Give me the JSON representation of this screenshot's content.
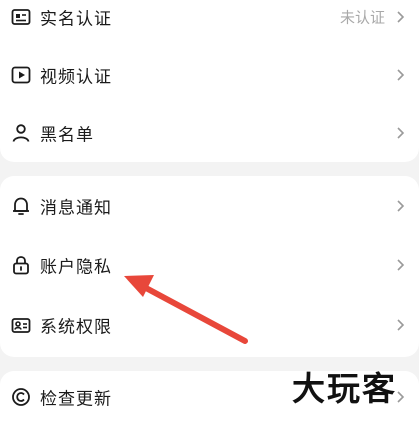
{
  "settings": {
    "group1": [
      {
        "label": "实名认证",
        "value": "未认证",
        "icon": "id-card-icon"
      },
      {
        "label": "视频认证",
        "value": "",
        "icon": "video-play-icon"
      },
      {
        "label": "黑名单",
        "value": "",
        "icon": "person-icon"
      }
    ],
    "group2": [
      {
        "label": "消息通知",
        "value": "",
        "icon": "bell-icon"
      },
      {
        "label": "账户隐私",
        "value": "",
        "icon": "lock-icon"
      },
      {
        "label": "系统权限",
        "value": "",
        "icon": "permission-icon"
      }
    ],
    "group3": [
      {
        "label": "检查更新",
        "value": "",
        "icon": "refresh-copyright-icon"
      }
    ]
  },
  "annotation": {
    "arrow_color": "#e8473a"
  },
  "watermark": {
    "text": "大玩客"
  }
}
